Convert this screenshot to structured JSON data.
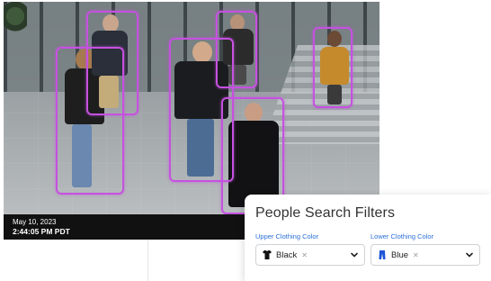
{
  "camera": {
    "date": "May 10, 2023",
    "time": "2:44:05 PM PDT"
  },
  "detection_box_color": "#c651e0",
  "filters": {
    "title": "People Search Filters",
    "upper": {
      "label": "Upper Clothing Color",
      "value": "Black",
      "icon": "shirt-icon",
      "icon_color": "#111111"
    },
    "lower": {
      "label": "Lower Clothing Color",
      "value": "Blue",
      "icon": "pants-icon",
      "icon_color": "#1f55d6"
    }
  }
}
